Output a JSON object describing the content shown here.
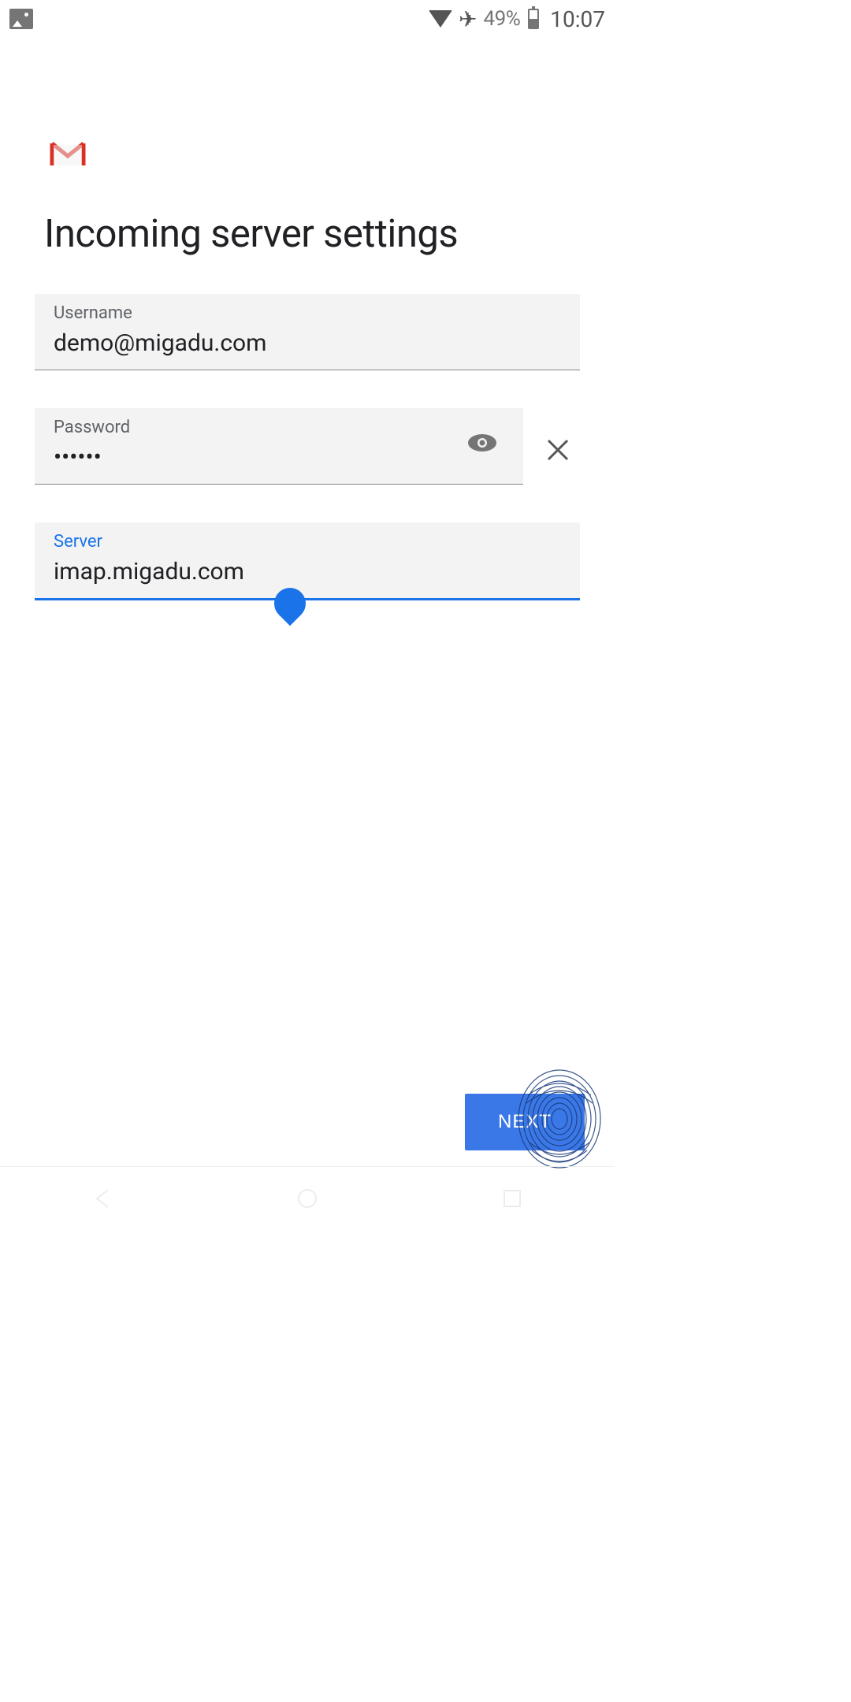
{
  "status_bar": {
    "battery_percent": "49%",
    "time": "10:07"
  },
  "page": {
    "title": "Incoming server settings"
  },
  "fields": {
    "username": {
      "label": "Username",
      "value": "demo@migadu.com"
    },
    "password": {
      "label": "Password",
      "value": "••••••"
    },
    "server": {
      "label": "Server",
      "value": "imap.migadu.com"
    }
  },
  "buttons": {
    "next": "NEXT"
  }
}
